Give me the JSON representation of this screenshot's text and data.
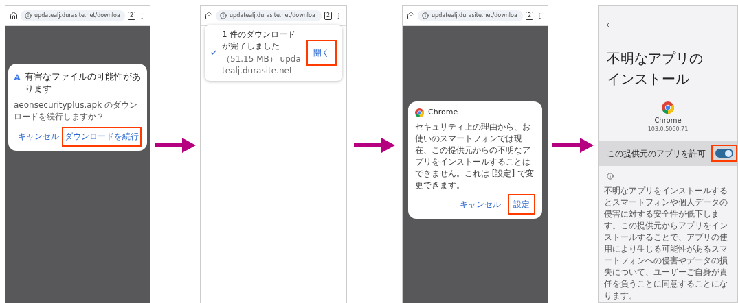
{
  "panels": [
    {
      "kind": "browser_dialog",
      "url": "updatealj.durasite.net/downloa",
      "tab_count": "2",
      "dialog": {
        "title": "有害なファイルの可能性があります",
        "message": "aeonsecurityplus.apk のダウンロードを続行しますか？",
        "buttons": [
          {
            "label": "キャンセル",
            "highlighted": false
          },
          {
            "label": "ダウンロードを続行",
            "highlighted": true
          }
        ]
      }
    },
    {
      "kind": "download_notice",
      "url": "updatealj.durasite.net/downloa",
      "tab_count": "2",
      "notice": {
        "title": "1 件のダウンロードが完了しました",
        "detail": "（51.15 MB） updatealj.durasite.net",
        "button": {
          "label": "開く",
          "highlighted": true
        }
      }
    },
    {
      "kind": "app_dialog",
      "url": "updatealj.durasite.net/downloa",
      "tab_count": "2",
      "dialog": {
        "app": "Chrome",
        "message": "セキュリティ上の理由から、お使いのスマートフォンでは現在、この提供元からの不明なアプリをインストールすることはできません。これは [設定] で変更できます。",
        "buttons": [
          {
            "label": "キャンセル",
            "highlighted": false
          },
          {
            "label": "設定",
            "highlighted": true
          }
        ]
      }
    },
    {
      "kind": "settings",
      "title_lines": [
        "不明なアプリの",
        "インストール"
      ],
      "app_name": "Chrome",
      "version": "103.0.5060.71",
      "setting": {
        "label": "この提供元のアプリを許可",
        "on": true,
        "highlighted": true
      },
      "note": "不明なアプリをインストールするとスマートフォンや個人データの侵害に対する安全性が低下します。この提供元からアプリをインストールすることで、アプリの使用により生じる可能性があるスマートフォンへの侵害やデータの損失について、ユーザーご自身が責任を負うことに同意することになります。"
    }
  ]
}
